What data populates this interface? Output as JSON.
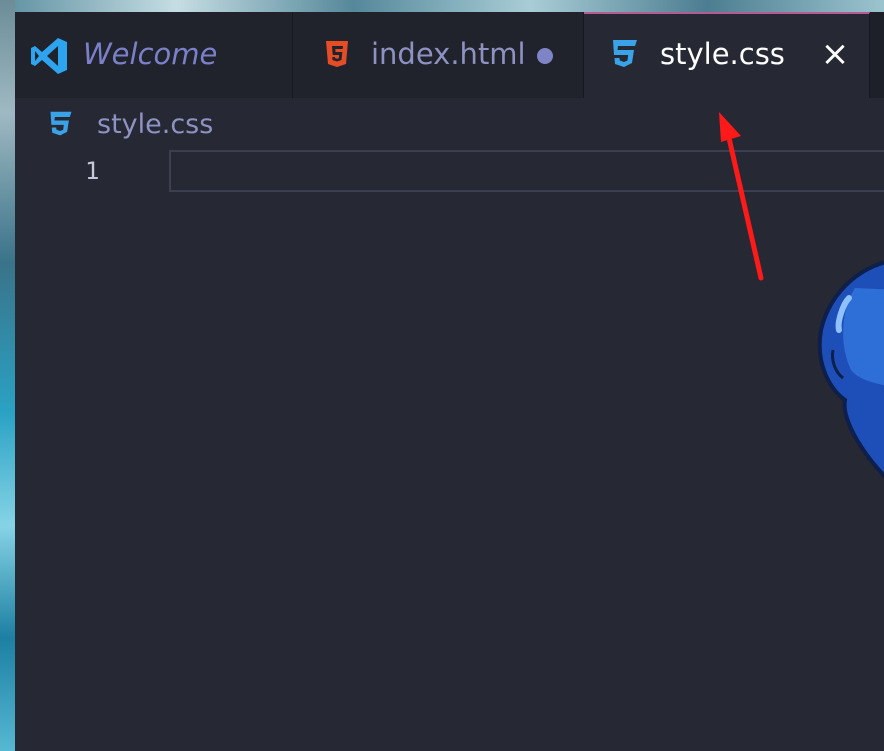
{
  "tabs": [
    {
      "label": "Welcome",
      "icon": "vscode-icon"
    },
    {
      "label": "index.html",
      "icon": "html5-icon",
      "unsaved": true
    },
    {
      "label": "style.css",
      "icon": "css3-icon",
      "active": true
    }
  ],
  "breadcrumb": {
    "file": "style.css",
    "icon": "css3-icon"
  },
  "editor": {
    "line_numbers": [
      "1"
    ],
    "content": ""
  },
  "colors": {
    "editor_bg": "#262833",
    "tabbar_bg": "#1d1f29",
    "active_tab_border": "#b45a95",
    "vscode_blue": "#2ea3ee",
    "html_orange": "#e44d26",
    "css_blue": "#3aa3e8",
    "annotation_red": "#ff1a1a"
  }
}
